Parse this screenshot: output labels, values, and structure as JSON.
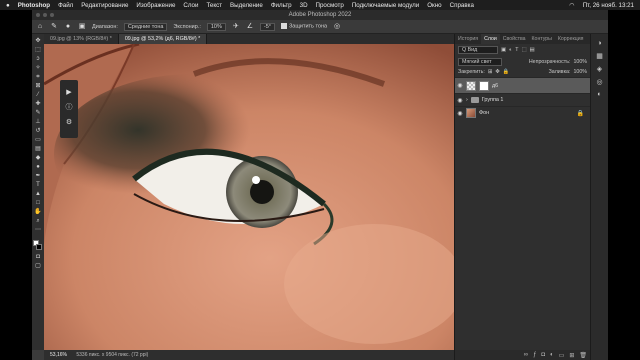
{
  "menubar": {
    "apple": "",
    "app": "Photoshop",
    "items": [
      "Файл",
      "Редактирование",
      "Изображение",
      "Слои",
      "Текст",
      "Выделение",
      "Фильтр",
      "3D",
      "Просмотр",
      "Подключаемые модули",
      "Окно",
      "Справка"
    ],
    "datetime": "Пт, 26 нояб.  13:21"
  },
  "window": {
    "title": "Adobe Photoshop 2022"
  },
  "options": {
    "range_label": "Диапазон:",
    "range_value": "Средние тона",
    "exposure_label": "Экспонир.:",
    "exposure_value": "10%",
    "angle_value": "-5°",
    "protect_label": "Защитить тона"
  },
  "tabs": [
    {
      "label": "09.jpg @ 13% (RGB/8#) *"
    },
    {
      "label": "09.jpg @ 53,2% (д6, RGB/8#) *"
    }
  ],
  "status": {
    "zoom": "53,16%",
    "info": "5336 пикс. x 9504 пикс. (72 ppi)"
  },
  "panel": {
    "tabs": [
      "История",
      "Слои",
      "Свойства",
      "Контуры",
      "Коррекция"
    ],
    "filter_kind": "Q Вид",
    "blend_mode": "Мягкий свет",
    "opacity_label": "Непрозрачность:",
    "opacity_value": "100%",
    "lock_label": "Закрепить:",
    "fill_label": "Заливка:",
    "fill_value": "100%",
    "layers": [
      {
        "name": "д6",
        "type": "pixel-mask",
        "selected": true
      },
      {
        "name": "Группа 1",
        "type": "group",
        "selected": false
      },
      {
        "name": "Фон",
        "type": "background",
        "selected": false
      }
    ]
  },
  "icons": {
    "eye": "eye-icon",
    "lock": "lock-icon",
    "folder": "folder-icon"
  },
  "colors": {
    "ui_dark": "#3b3b3b",
    "selected_layer": "#5a5a5a",
    "skin": "#cf8a6c"
  }
}
